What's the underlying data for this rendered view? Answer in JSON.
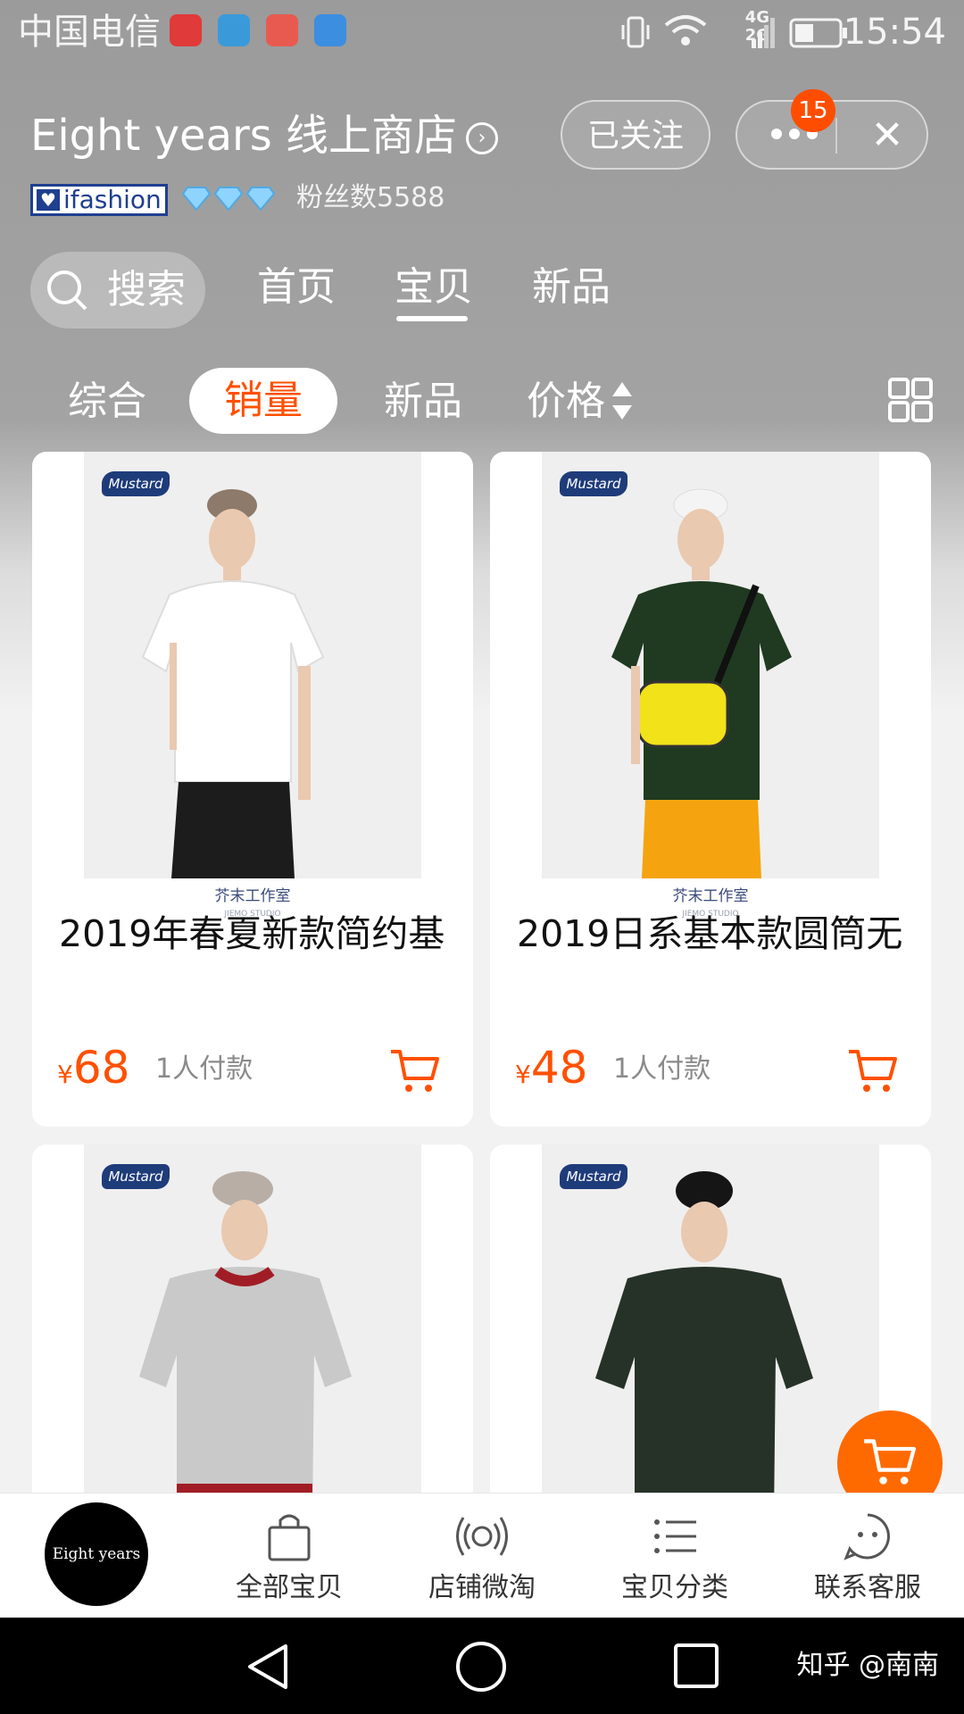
{
  "status_bar": {
    "carrier": "中国电信",
    "network": "4G\n2G",
    "time": "15:54",
    "app_icons": [
      "netease-music-icon",
      "browser-icon",
      "mail-icon",
      "gallery-icon"
    ]
  },
  "shop": {
    "name": "Eight years 线上商店",
    "follow_label": "已关注",
    "notification_count": "15",
    "brand_badge": "ifashion",
    "fans": "粉丝数5588"
  },
  "nav": {
    "search_label": "搜索",
    "tabs": [
      "首页",
      "宝贝",
      "新品"
    ],
    "active_tab": "宝贝"
  },
  "sort": {
    "items": [
      "综合",
      "销量",
      "新品",
      "价格"
    ],
    "active": "销量"
  },
  "products": [
    {
      "brand": "Mustard",
      "studio": "芥末工作室",
      "studio_en": "JIEMO STUDIO",
      "title": "2019年春夏新款简约基",
      "currency": "¥",
      "price": "68",
      "sold": "1人付款",
      "shirt_color": "#ffffff",
      "pants_color": "#1c1c1c"
    },
    {
      "brand": "Mustard",
      "studio": "芥末工作室",
      "studio_en": "JIEMO STUDIO",
      "title": "2019日系基本款圆筒无",
      "currency": "¥",
      "price": "48",
      "sold": "1人付款",
      "shirt_color": "#1f3a20",
      "pants_color": "#f5a40f"
    },
    {
      "brand": "Mustard",
      "shirt_color": "#c9c9c9",
      "pants_color": "#a11d25"
    },
    {
      "brand": "Mustard",
      "shirt_color": "#263228",
      "pants_color": "#1c1c1c"
    }
  ],
  "tabbar": {
    "shop_logo": "Eight years",
    "items": [
      {
        "label": "全部宝贝",
        "icon": "shopping-bag-icon"
      },
      {
        "label": "店铺微淘",
        "icon": "broadcast-icon"
      },
      {
        "label": "宝贝分类",
        "icon": "list-icon"
      },
      {
        "label": "联系客服",
        "icon": "chat-face-icon"
      }
    ]
  },
  "watermark": "知乎 @南南",
  "colors": {
    "accent": "#ff5000"
  }
}
